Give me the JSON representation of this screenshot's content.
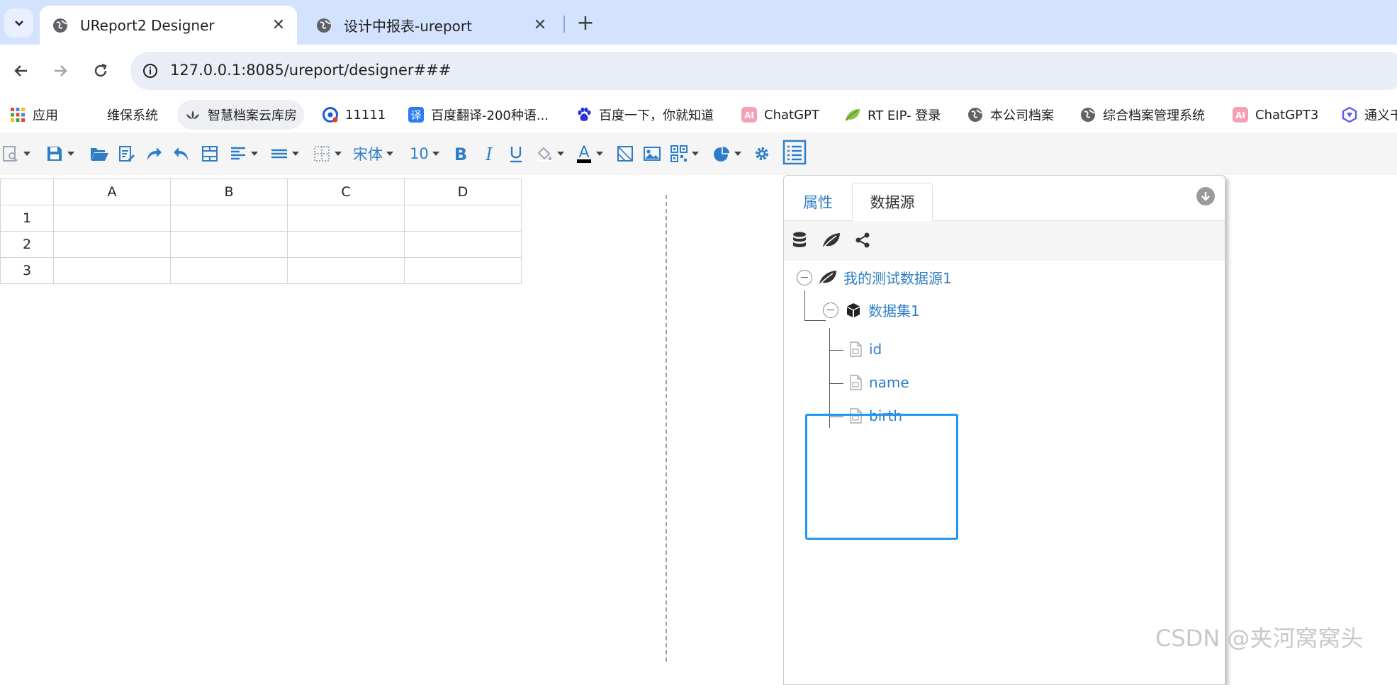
{
  "browser": {
    "tabs": [
      {
        "title": "UReport2 Designer",
        "active": true
      },
      {
        "title": "设计中报表-ureport",
        "active": false
      }
    ],
    "url": "127.0.0.1:8085/ureport/designer###",
    "bookmarks": [
      {
        "label": "应用",
        "icon": "apps-grid-icon"
      },
      {
        "label": "维保系统",
        "icon": ""
      },
      {
        "label": "智慧档案云库房",
        "icon": "lotus-icon"
      },
      {
        "label": "11111",
        "icon": "circle-logo-icon"
      },
      {
        "label": "百度翻译-200种语...",
        "icon": "translate-icon"
      },
      {
        "label": "百度一下，你就知道",
        "icon": "baidu-paw-icon"
      },
      {
        "label": "ChatGPT",
        "icon": "ai-icon"
      },
      {
        "label": "RT EIP- 登录",
        "icon": "leaf-icon"
      },
      {
        "label": "本公司档案",
        "icon": "globe-icon"
      },
      {
        "label": "综合档案管理系统",
        "icon": "globe-icon"
      },
      {
        "label": "ChatGPT3",
        "icon": "ai-icon"
      },
      {
        "label": "通义千",
        "icon": "tongyi-icon"
      }
    ]
  },
  "designer": {
    "font_name": "宋体",
    "font_size": "10",
    "columns": [
      "A",
      "B",
      "C",
      "D"
    ],
    "rows": [
      "1",
      "2",
      "3"
    ]
  },
  "panel": {
    "tabs": [
      "属性",
      "数据源"
    ],
    "active_tab": "数据源",
    "tree": {
      "datasource": "我的测试数据源1",
      "dataset": "数据集1",
      "fields": [
        "id",
        "name",
        "birth"
      ]
    }
  },
  "watermark": "CSDN @夹河窝窝头",
  "colors": {
    "accent": "#2e7ec7",
    "highlight": "#2196f3",
    "tabstrip": "#d3e3fd"
  }
}
